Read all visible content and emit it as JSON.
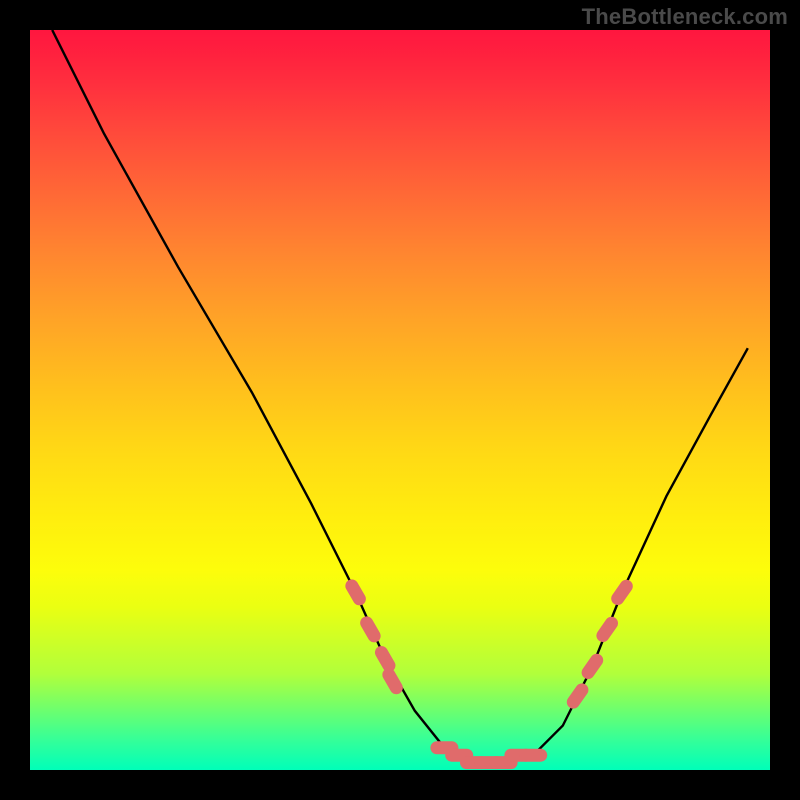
{
  "watermark": "TheBottleneck.com",
  "colors": {
    "frame": "#000000",
    "curve": "#000000",
    "markers": "#e06b6b",
    "gradient_top": "#ff163f",
    "gradient_bottom": "#00ffb9"
  },
  "chart_data": {
    "type": "line",
    "title": "",
    "xlabel": "",
    "ylabel": "",
    "xlim": [
      0,
      100
    ],
    "ylim": [
      0,
      100
    ],
    "series": [
      {
        "name": "bottleneck-curve",
        "x": [
          3,
          10,
          20,
          30,
          38,
          44,
          48,
          52,
          56,
          60,
          64,
          68,
          72,
          76,
          80,
          86,
          92,
          97
        ],
        "y": [
          100,
          86,
          68,
          51,
          36,
          24,
          15,
          8,
          3,
          1,
          1,
          2,
          6,
          14,
          24,
          37,
          48,
          57
        ]
      }
    ],
    "markers": [
      {
        "name": "left-cluster",
        "x": [
          44,
          46,
          48,
          49
        ],
        "y": [
          24,
          19,
          15,
          12
        ]
      },
      {
        "name": "bottom-cluster",
        "x": [
          56,
          58,
          60,
          62,
          64,
          66,
          68
        ],
        "y": [
          3,
          2,
          1,
          1,
          1,
          2,
          2
        ]
      },
      {
        "name": "right-cluster",
        "x": [
          74,
          76,
          78,
          80
        ],
        "y": [
          10,
          14,
          19,
          24
        ]
      }
    ],
    "annotations": []
  }
}
